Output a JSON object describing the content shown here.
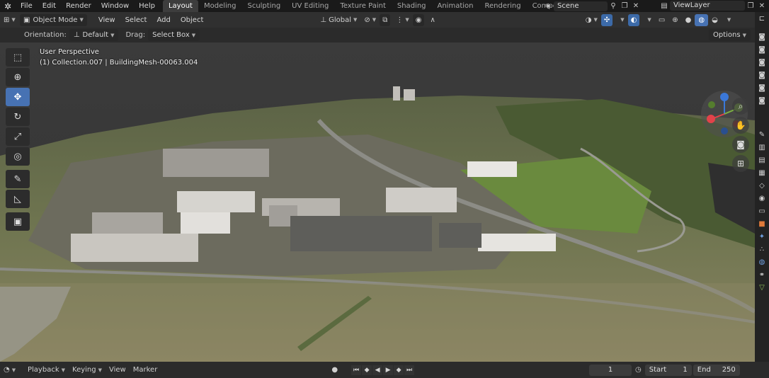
{
  "topbar": {
    "menus": [
      "File",
      "Edit",
      "Render",
      "Window",
      "Help"
    ],
    "workspaces": [
      "Layout",
      "Modeling",
      "Sculpting",
      "UV Editing",
      "Texture Paint",
      "Shading",
      "Animation",
      "Rendering",
      "Compositin"
    ],
    "active_workspace": "Layout",
    "scene_name": "Scene",
    "view_layer": "ViewLayer"
  },
  "viewport_header": {
    "mode": "Object Mode",
    "menus": [
      "View",
      "Select",
      "Add",
      "Object"
    ],
    "transform_orientation": "Global",
    "options_label": "Options"
  },
  "tool_settings": {
    "orientation_label": "Orientation:",
    "orientation_value": "Default",
    "drag_label": "Drag:",
    "drag_value": "Select Box"
  },
  "overlay": {
    "view_name": "User Perspective",
    "object_info": "(1) Collection.007 | BuildingMesh-00063.004"
  },
  "toolbar": {
    "tools": [
      "select-box",
      "cursor",
      "move",
      "rotate",
      "scale",
      "transform",
      "annotate",
      "measure",
      "add-cube"
    ],
    "active_tool": "move"
  },
  "navigation": [
    "zoom",
    "pan",
    "camera",
    "perspective"
  ],
  "timeline": {
    "menus": [
      "Playback",
      "Keying",
      "View",
      "Marker"
    ],
    "current_frame": "1",
    "start_label": "Start",
    "start": "1",
    "end_label": "End",
    "end": "250"
  },
  "colors": {
    "accent": "#4772b3",
    "active_tab": "#3d3d3d",
    "gizmo_x": "#e2424a",
    "gizmo_y": "#7cb342",
    "gizmo_z": "#3b78d8"
  }
}
